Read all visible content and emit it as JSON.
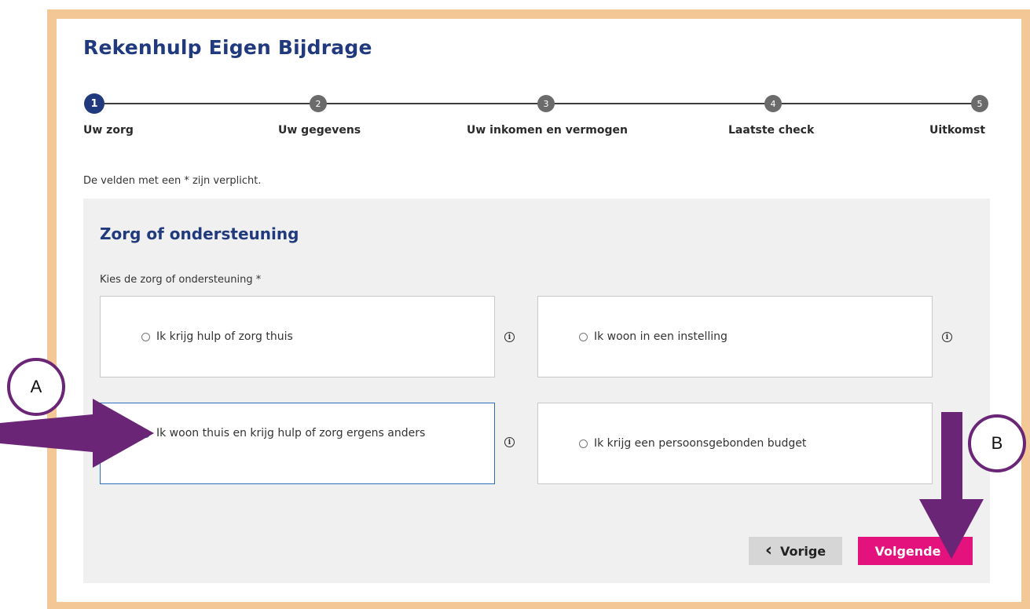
{
  "title": "Rekenhulp Eigen Bijdrage",
  "steps": [
    {
      "number": "1",
      "label": "Uw zorg"
    },
    {
      "number": "2",
      "label": "Uw gegevens"
    },
    {
      "number": "3",
      "label": "Uw inkomen en vermogen"
    },
    {
      "number": "4",
      "label": "Laatste check"
    },
    {
      "number": "5",
      "label": "Uitkomst"
    }
  ],
  "active_step": 1,
  "required_note": "De velden met een * zijn verplicht.",
  "panel": {
    "title": "Zorg of ondersteuning",
    "question": "Kies de zorg of ondersteuning *",
    "options": [
      {
        "label": "Ik krijg hulp of zorg thuis",
        "selected": false
      },
      {
        "label": "Ik woon in een instelling",
        "selected": false
      },
      {
        "label": "Ik woon thuis en krijg hulp of zorg ergens anders",
        "selected": true
      },
      {
        "label": "Ik krijg een persoonsgebonden budget",
        "selected": false
      }
    ],
    "info_icon_glyph": "i"
  },
  "buttons": {
    "prev_label": "Vorige",
    "prev_icon": "‹",
    "next_label": "Volgende",
    "next_icon": "›"
  },
  "annotations": {
    "a_label": "A",
    "b_label": "B"
  },
  "colors": {
    "frame": "#f4c896",
    "title": "#213a7d",
    "accent": "#e3127d",
    "selected_border": "#2b6fb8",
    "annotation": "#6a2577"
  }
}
